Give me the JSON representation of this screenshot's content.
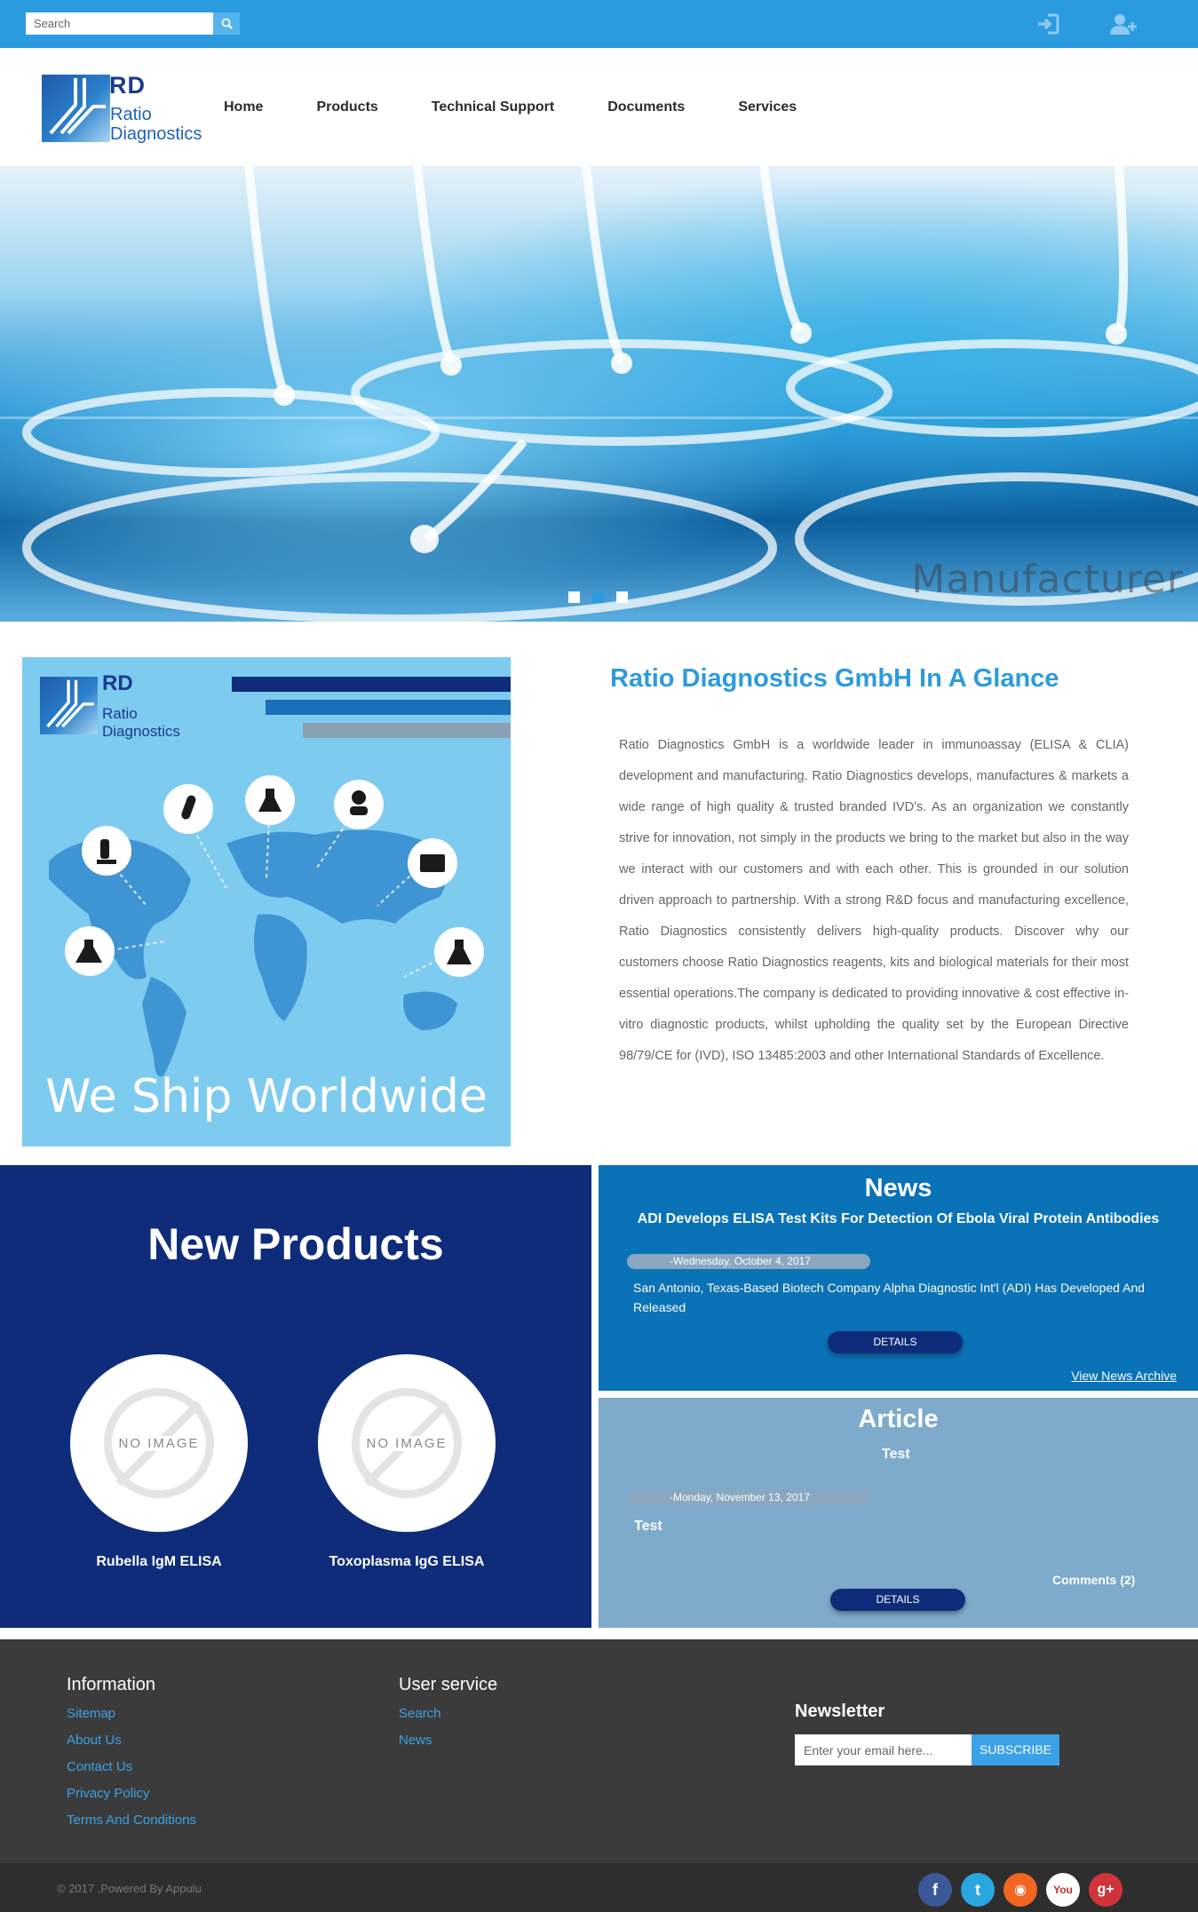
{
  "topbar": {
    "search_placeholder": "Search",
    "icons": [
      "search-icon",
      "login-icon",
      "register-icon"
    ]
  },
  "logo": {
    "abbr": "RD",
    "line1": "Ratio",
    "line2": "Diagnostics"
  },
  "nav": {
    "items": [
      {
        "label": "Home"
      },
      {
        "label": "Products"
      },
      {
        "label": "Technical Support"
      },
      {
        "label": "Documents"
      },
      {
        "label": "Services"
      }
    ]
  },
  "hero": {
    "caption": "Manufacturer",
    "slides": 3,
    "active_slide": 2
  },
  "intro": {
    "image_logo": {
      "abbr": "RD",
      "line1": "Ratio",
      "line2": "Diagnostics"
    },
    "image_caption": "We Ship Worldwide",
    "title": "Ratio Diagnostics GmbH In A Glance",
    "text": "Ratio Diagnostics GmbH is a worldwide leader in immunoassay (ELISA & CLIA) development and manufacturing. Ratio Diagnostics develops, manufactures & markets a wide range of high quality & trusted branded IVD's. As an organization we constantly strive for innovation, not simply in the products we bring to the market but also in the way we interact with our customers and with each other. This is grounded in our solution driven approach to partnership. With a strong R&D focus and manufacturing excellence, Ratio Diagnostics consistently delivers high-quality products. Discover why our customers choose Ratio Diagnostics reagents, kits and biological materials for their most essential operations.The company is dedicated to providing innovative & cost effective in-vitro diagnostic products, whilst upholding the quality set by the European Directive 98/79/CE for (IVD), ISO 13485:2003 and other International Standards of Excellence."
  },
  "new_products": {
    "title": "New Products",
    "no_image_label": "NO IMAGE",
    "items": [
      {
        "name": "Rubella IgM ELISA"
      },
      {
        "name": "Toxoplasma IgG ELISA"
      }
    ]
  },
  "news": {
    "title": "News",
    "headline": "ADI Develops ELISA Test Kits For Detection Of Ebola Viral Protein Antibodies",
    "date": "-Wednesday, October 4, 2017",
    "body": "San Antonio, Texas-Based Biotech Company Alpha Diagnostic Int'l (ADI) Has Developed And Released",
    "details_label": "DETAILS",
    "archive_label": "View News Archive"
  },
  "article": {
    "title": "Article",
    "subtitle": "Test",
    "date": "-Monday, November 13, 2017",
    "body": "Test",
    "comments_label": "Comments (2)",
    "details_label": "DETAILS"
  },
  "footer": {
    "information": {
      "title": "Information",
      "links": [
        "Sitemap",
        "About Us",
        "Contact Us",
        "Privacy Policy",
        "Terms And Conditions"
      ]
    },
    "user_service": {
      "title": "User service",
      "links": [
        "Search",
        "News"
      ]
    },
    "newsletter": {
      "title": "Newsletter",
      "placeholder": "Enter your email here...",
      "button": "SUBSCRIBE"
    },
    "copyright": "© 2017 ,Powered By Appulu",
    "social": [
      {
        "icon": "facebook-icon",
        "glyph": "f",
        "color": "#3b5998"
      },
      {
        "icon": "twitter-icon",
        "glyph": "t",
        "color": "#2aa6df"
      },
      {
        "icon": "rss-icon",
        "glyph": "◉",
        "color": "#f26522"
      },
      {
        "icon": "youtube-icon",
        "glyph": "You",
        "color": "#ffffff"
      },
      {
        "icon": "googleplus-icon",
        "glyph": "g+",
        "color": "#d0343a"
      }
    ]
  },
  "colors": {
    "topbar": "#2b9be0",
    "accent": "#2e9bdc",
    "new_products_bg": "#0e2c7a",
    "news_bg": "#0a72b6",
    "article_bg": "#7eaacb",
    "footer_bg": "#3b3b3b"
  }
}
